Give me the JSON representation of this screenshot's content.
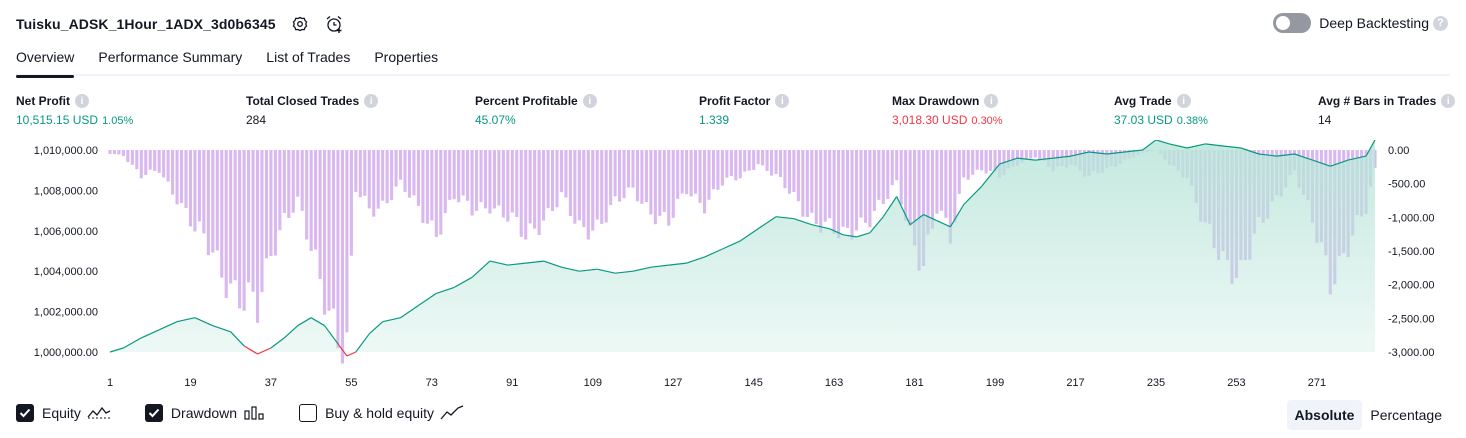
{
  "header": {
    "strategy_name": "Tuisku_ADSK_1Hour_1ADX_3d0b6345",
    "deep_backtesting_label": "Deep Backtesting",
    "help_glyph": "?"
  },
  "icons": {
    "settings": "gear-icon",
    "alert": "alarm-clock-plus-icon",
    "info": "info-icon"
  },
  "tabs": [
    {
      "label": "Overview",
      "active": true
    },
    {
      "label": "Performance Summary",
      "active": false
    },
    {
      "label": "List of Trades",
      "active": false
    },
    {
      "label": "Properties",
      "active": false
    }
  ],
  "metrics": [
    {
      "label": "Net Profit",
      "value": "10,515.15 USD",
      "sub": "1.05%",
      "tone": "pos"
    },
    {
      "label": "Total Closed Trades",
      "value": "284",
      "sub": "",
      "tone": "neu"
    },
    {
      "label": "Percent Profitable",
      "value": "45.07%",
      "sub": "",
      "tone": "pos"
    },
    {
      "label": "Profit Factor",
      "value": "1.339",
      "sub": "",
      "tone": "pos"
    },
    {
      "label": "Max Drawdown",
      "value": "3,018.30 USD",
      "sub": "0.30%",
      "tone": "neg"
    },
    {
      "label": "Avg Trade",
      "value": "37.03 USD",
      "sub": "0.38%",
      "tone": "pos"
    },
    {
      "label": "Avg # Bars in Trades",
      "value": "14",
      "sub": "",
      "tone": "neu"
    }
  ],
  "legend": {
    "equity_label": "Equity",
    "drawdown_label": "Drawdown",
    "buyhold_label": "Buy & hold equity",
    "equity_checked": true,
    "drawdown_checked": true,
    "buyhold_checked": false
  },
  "mode": {
    "absolute_label": "Absolute",
    "percentage_label": "Percentage",
    "active": "Absolute"
  },
  "colors": {
    "equity_line": "#089981",
    "equity_fill": "#b9e5d9",
    "below_start": "#f23645",
    "drawdown_bar": "#d9b8f0",
    "positive": "#089981",
    "negative": "#f23645"
  },
  "chart_data": {
    "type": "area",
    "x_ticks": [
      "1",
      "19",
      "37",
      "55",
      "73",
      "91",
      "109",
      "127",
      "145",
      "163",
      "181",
      "199",
      "217",
      "235",
      "253",
      "271"
    ],
    "x_range": [
      1,
      284
    ],
    "y_left_ticks": [
      "1,010,000.00",
      "1,008,000.00",
      "1,006,000.00",
      "1,004,000.00",
      "1,002,000.00",
      "1,000,000.00"
    ],
    "y_left_range": [
      1000000,
      1010000
    ],
    "y_right_ticks": [
      "0.00",
      "-500.00",
      "-1,000.00",
      "-1,500.00",
      "-2,000.00",
      "-2,500.00",
      "-3,000.00"
    ],
    "y_right_range": [
      -3000,
      0
    ],
    "equity_start": 1000000,
    "series": [
      {
        "name": "Equity",
        "x": [
          1,
          4,
          8,
          12,
          16,
          20,
          24,
          28,
          31,
          34,
          37,
          40,
          43,
          46,
          49,
          52,
          54,
          56,
          59,
          62,
          66,
          70,
          74,
          78,
          82,
          86,
          90,
          94,
          98,
          102,
          106,
          110,
          114,
          118,
          122,
          126,
          130,
          134,
          138,
          142,
          146,
          150,
          154,
          158,
          162,
          165,
          168,
          171,
          174,
          177,
          180,
          183,
          186,
          189,
          192,
          196,
          200,
          204,
          208,
          212,
          216,
          220,
          224,
          228,
          232,
          235,
          238,
          242,
          246,
          250,
          254,
          258,
          262,
          266,
          270,
          274,
          278,
          282,
          284
        ],
        "values": [
          1000000,
          1000200,
          1000700,
          1001100,
          1001500,
          1001700,
          1001300,
          1001000,
          1000300,
          999900,
          1000200,
          1000700,
          1001300,
          1001700,
          1001300,
          1000400,
          999800,
          1000000,
          1000900,
          1001500,
          1001700,
          1002300,
          1002900,
          1003200,
          1003700,
          1004500,
          1004300,
          1004400,
          1004500,
          1004200,
          1004000,
          1004100,
          1003900,
          1004000,
          1004200,
          1004300,
          1004400,
          1004700,
          1005100,
          1005500,
          1006100,
          1006700,
          1006600,
          1006300,
          1006100,
          1005800,
          1005700,
          1005900,
          1006700,
          1007700,
          1006300,
          1006800,
          1006500,
          1006200,
          1007300,
          1008200,
          1009300,
          1009600,
          1009500,
          1009600,
          1009700,
          1009900,
          1009800,
          1009900,
          1010000,
          1010500,
          1010300,
          1010100,
          1010300,
          1010200,
          1010100,
          1009800,
          1009700,
          1009800,
          1009500,
          1009200,
          1009500,
          1009700,
          1010500
        ]
      },
      {
        "name": "Drawdown",
        "x": [
          1,
          4,
          8,
          12,
          16,
          20,
          24,
          28,
          31,
          34,
          37,
          40,
          43,
          46,
          49,
          52,
          54,
          56,
          59,
          62,
          66,
          70,
          74,
          78,
          82,
          86,
          90,
          94,
          98,
          102,
          106,
          110,
          114,
          118,
          122,
          126,
          130,
          134,
          138,
          142,
          146,
          150,
          154,
          158,
          162,
          165,
          168,
          171,
          174,
          177,
          180,
          183,
          186,
          189,
          192,
          196,
          200,
          204,
          208,
          212,
          216,
          220,
          224,
          228,
          232,
          235,
          238,
          242,
          246,
          250,
          254,
          258,
          262,
          266,
          270,
          274,
          278,
          282,
          284
        ],
        "values": [
          -50,
          -80,
          -400,
          -300,
          -700,
          -1200,
          -1500,
          -2000,
          -2300,
          -2400,
          -1500,
          -1000,
          -800,
          -1500,
          -2100,
          -2700,
          -3000,
          -600,
          -900,
          -800,
          -500,
          -900,
          -1200,
          -700,
          -900,
          -800,
          -1000,
          -1300,
          -1000,
          -700,
          -1200,
          -1100,
          -800,
          -600,
          -900,
          -1100,
          -600,
          -800,
          -500,
          -400,
          -200,
          -400,
          -700,
          -1000,
          -1200,
          -1300,
          -1100,
          -1000,
          -800,
          -500,
          -1200,
          -1700,
          -900,
          -1300,
          -400,
          -300,
          -400,
          -200,
          -100,
          -300,
          -200,
          -400,
          -300,
          -150,
          -50,
          0,
          -200,
          -400,
          -1200,
          -1600,
          -1800,
          -1200,
          -700,
          -300,
          -1100,
          -1900,
          -1400,
          -900,
          -300
        ]
      }
    ],
    "grid": false,
    "legend_position": "bottom-left"
  }
}
